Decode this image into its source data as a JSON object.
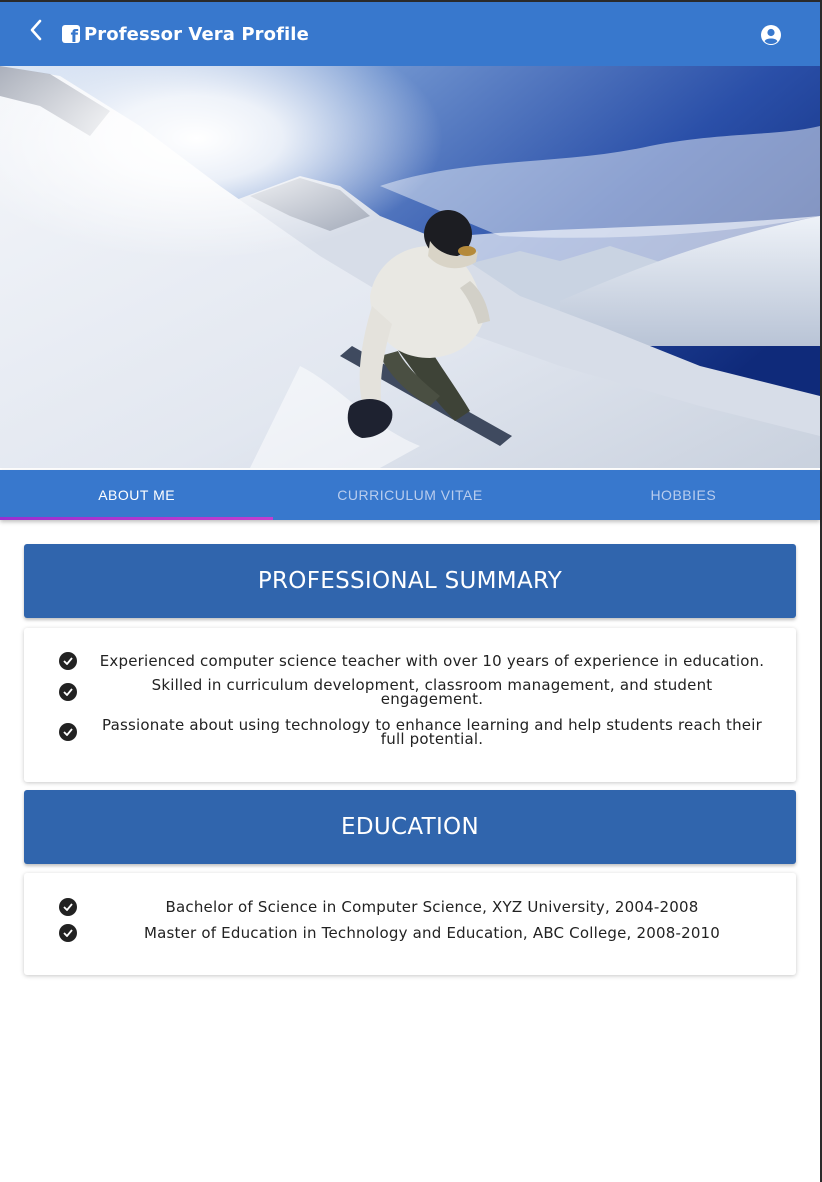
{
  "app_bar": {
    "title": "Professor Vera Profile",
    "back_icon": "chevron-left-icon",
    "brand_icon": "facebook-icon",
    "account_icon": "account-circle-icon",
    "background": "#3878cd"
  },
  "hero": {
    "image": "snowboarder-on-mountain-slope"
  },
  "tabs": [
    {
      "label": "ABOUT ME",
      "active": true
    },
    {
      "label": "CURRICULUM VITAE",
      "active": false
    },
    {
      "label": "HOBBIES",
      "active": false
    }
  ],
  "sections": {
    "professional_summary": {
      "title": "PROFESSIONAL SUMMARY",
      "items": [
        "Experienced computer science teacher with over 10 years of experience in education.",
        "Skilled in curriculum development, classroom management, and student engagement.",
        "Passionate about using technology to enhance learning and help students reach their full potential."
      ]
    },
    "education": {
      "title": "EDUCATION",
      "items": [
        "Bachelor of Science in Computer Science, XYZ University, 2004-2008",
        "Master of Education in Technology and Education, ABC College, 2008-2010"
      ]
    }
  },
  "colors": {
    "section_header": "#3065ad",
    "tab_indicator": "#b039cf",
    "check_icon": "#222222"
  }
}
